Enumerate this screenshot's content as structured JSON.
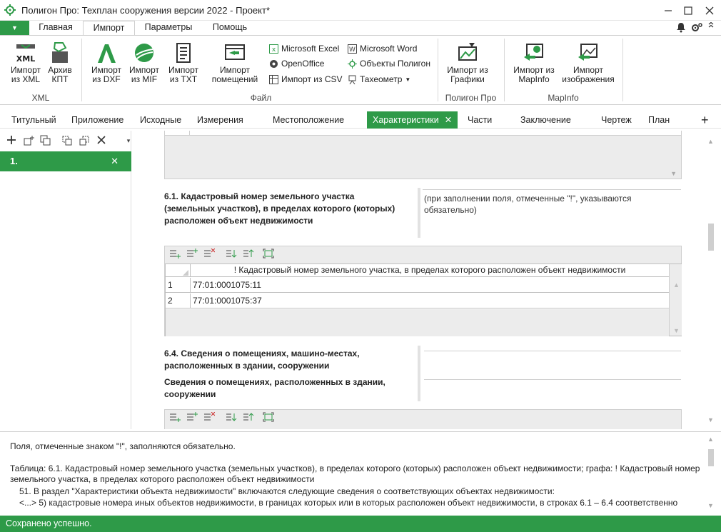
{
  "window": {
    "title": "Полигон Про: Техплан сооружения версии 2022 - Проект*",
    "buttons": [
      "minimize",
      "maximize",
      "close"
    ]
  },
  "ribbon_tabs": {
    "file_glyph": "▼",
    "items": [
      "Главная",
      "Импорт",
      "Параметры",
      "Помощь"
    ],
    "active": "Импорт"
  },
  "ribbon": {
    "xml_group": {
      "label": "XML",
      "import_xml": "Импорт\nиз XML",
      "archive_kpt": "Архив\nКПТ"
    },
    "file_group": {
      "label": "Файл",
      "import_dxf": "Импорт\nиз DXF",
      "import_mif": "Импорт\nиз MIF",
      "import_txt": "Импорт\nиз TXT",
      "import_rooms": "Импорт\nпомещений",
      "ms_excel": "Microsoft Excel",
      "openoffice": "OpenOffice",
      "import_csv": "Импорт из CSV",
      "ms_word": "Microsoft Word",
      "polygon_objects": "Объекты Полигон",
      "tacheometer": "Тахеометр"
    },
    "polygon_group": {
      "label": "Полигон Про",
      "import_grafika": "Импорт из\nГрафики"
    },
    "mapinfo_group": {
      "label": "MapInfo",
      "import_mapinfo": "Импорт из\nMapInfo",
      "import_image": "Импорт\nизображения"
    }
  },
  "section_tabs": {
    "items": [
      "Титульный",
      "Приложение",
      "Исходные",
      "Измерения",
      "Местоположение",
      "Характеристики",
      "Части",
      "Заключение",
      "Чертеж",
      "План"
    ],
    "active": "Характеристики",
    "close_glyph": "✕",
    "add_glyph": "+"
  },
  "left_panel": {
    "selected_item": "1.",
    "close_glyph": "✕"
  },
  "main": {
    "section_61": {
      "title": "6.1. Кадастровый номер земельного участка (земельных участков), в пределах которого (которых) расположен объект недвижимости",
      "hint": "(при заполнении поля, отмеченные \"!\", указываются обязательно)",
      "table": {
        "column_header": "! Кадастровый номер земельного участка, в пределах которого расположен объект недвижимости",
        "rows": [
          {
            "num": "1",
            "value": "77:01:0001075:11"
          },
          {
            "num": "2",
            "value": "77:01:0001075:37"
          }
        ]
      }
    },
    "section_64": {
      "title": "6.4. Сведения о помещениях, машино-местах, расположенных в здании, сооружении",
      "subtitle": "Сведения о помещениях, расположенных в здании, сооружении"
    }
  },
  "info_pane": {
    "line1": "Поля, отмеченные знаком \"!\", заполняются обязательно.",
    "line2": "Таблица: 6.1. Кадастровый номер земельного участка (земельных участков), в пределах которого (которых) расположен объект недвижимости; графа: ! Кадастровый номер",
    "line3": "земельного участка, в пределах которого расположен объект недвижимости",
    "line4": "51. В раздел \"Характеристики объекта недвижимости\" включаются следующие сведения о соответствующих объектах недвижимости:",
    "line5": "<...> 5) кадастровые номера иных объектов недвижимости, в границах которых или в которых расположен объект недвижимости, в строках 6.1 – 6.4 соответственно"
  },
  "status": {
    "text": "Сохранено успешно."
  },
  "colors": {
    "accent_green": "#2e9a48"
  },
  "icons": [
    "app-icon",
    "bell-icon",
    "settings-icon",
    "chevron-icon"
  ]
}
